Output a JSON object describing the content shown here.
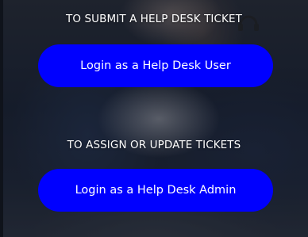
{
  "sections": [
    {
      "heading": "TO SUBMIT A HELP DESK TICKET",
      "button_label": "Login as a Help Desk User"
    },
    {
      "heading": "TO ASSIGN OR UPDATE TICKETS",
      "button_label": "Login as a Help Desk Admin"
    }
  ],
  "colors": {
    "button_bg": "#0000ff",
    "text": "#ffffff"
  }
}
